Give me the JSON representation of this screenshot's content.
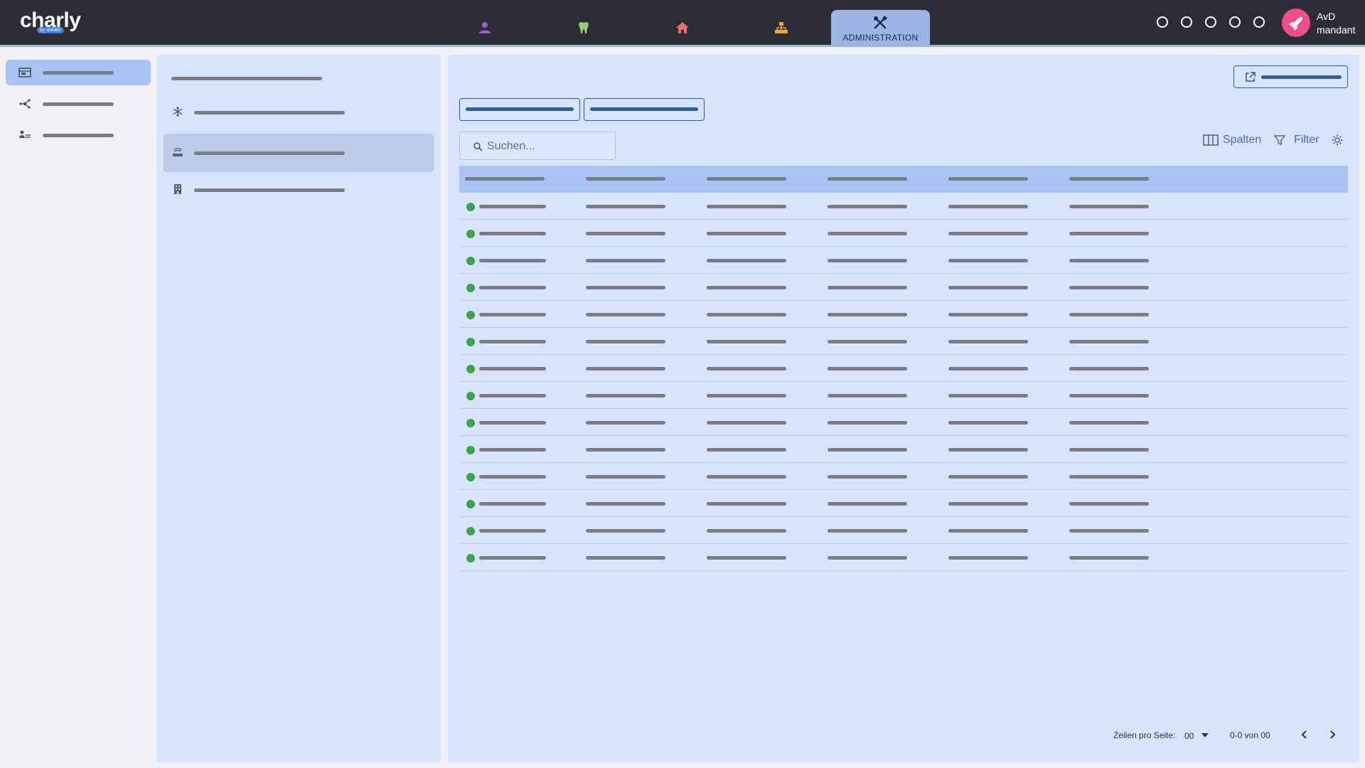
{
  "app": {
    "logo_text": "charly",
    "logo_badge": "by solutio"
  },
  "topnav": {
    "items": [
      {
        "icon": "person-icon",
        "color": "#a25ad9"
      },
      {
        "icon": "tooth-icon",
        "color": "#8fcf7a"
      },
      {
        "icon": "house-icon",
        "color": "#e0706b"
      },
      {
        "icon": "org-chart-icon",
        "color": "#e9a73e"
      }
    ],
    "active_tab": {
      "icon": "tools-icon",
      "label": "ADMINISTRATION"
    },
    "status_circles": 5,
    "user": {
      "line1": "AvD",
      "line2": "mandant",
      "avatar_color": "#ef4f82"
    }
  },
  "leftnav": {
    "items": [
      {
        "icon": "window-icon",
        "active": true
      },
      {
        "icon": "network-icon",
        "active": false
      },
      {
        "icon": "people-list-icon",
        "active": false
      }
    ]
  },
  "midpanel": {
    "items": [
      {
        "icon": "snowflake-icon",
        "active": false
      },
      {
        "icon": "router-icon",
        "active": true
      },
      {
        "icon": "building-icon",
        "active": false
      }
    ]
  },
  "main": {
    "search_placeholder": "Suchen...",
    "toolbar": {
      "columns_label": "Spalten",
      "filter_label": "Filter"
    },
    "table": {
      "column_count": 6,
      "row_count": 14,
      "status_color": "#3fa34d"
    },
    "footer": {
      "rows_per_page_label": "Zeilen pro Seite:",
      "rows_per_page_value": "00",
      "range_text": "0-0 von 00"
    }
  },
  "colors": {
    "topbar": "#2b2e36",
    "panel": "#d8e4fb",
    "accent": "#a9c3f5",
    "primary": "#2f5d9c"
  }
}
